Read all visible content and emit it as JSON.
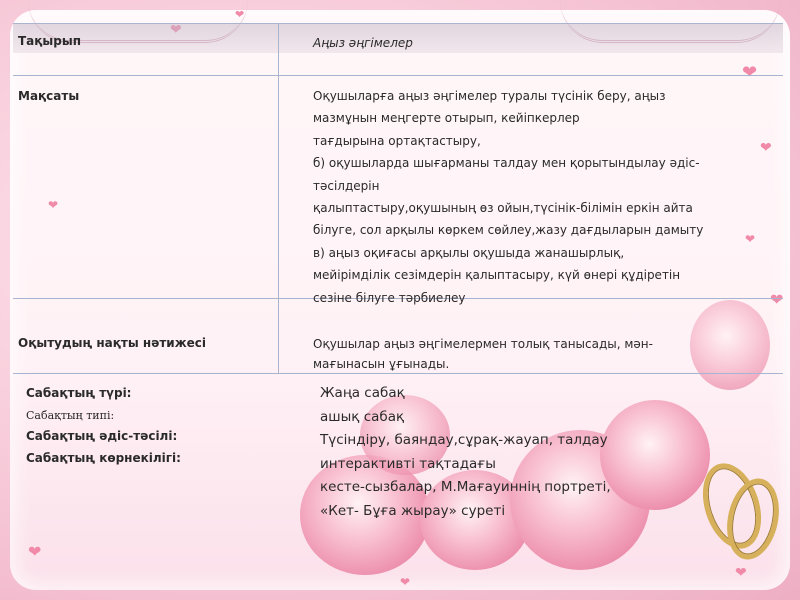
{
  "rows": [
    {
      "label": "Тақырып",
      "value_lines": [
        "Аңыз әңгімелер"
      ]
    },
    {
      "label": "Мақсаты",
      "value_lines": [
        "Оқушыларға аңыз әңгімелер туралы түсінік беру,  аңыз",
        "мазмұнын меңгерте отырып, кейіпкерлер",
        "тағдырына ортақтастыру,",
        "б) оқушыларда шығарманы талдау мен қорытындылау әдіс-",
        "тәсілдерін",
        "қалыптастыру,оқушының өз ойын,түсінік-білімін еркін айта",
        "білуге, сол арқылы көркем сөйлеу,жазу дағдыларын дамыту",
        "в) аңыз оқиғасы арқылы оқушыда жанашырлық,",
        "мейірімділік сезімдерін қалыптасыру, күй өнері құдіретін",
        "сезіне білуге тәрбиелеу"
      ]
    },
    {
      "label": "Оқытудың нақты нәтижесі",
      "value_lines": [
        "Оқушылар аңыз әңгімелермен толық танысады, мән-",
        "мағынасын ұғынады."
      ]
    }
  ],
  "lesson_labels": [
    "Сабақтың түрі:",
    "Сабақтың типі:",
    "Сабақтың әдіс-тәсілі:",
    "Сабақтың көрнекілігі:"
  ],
  "lesson_values": [
    "Жаңа сабақ",
    "ашық сабақ",
    "Түсіндіру, баяндау,сұрақ-жауап, талдау",
    "интерактивті тақтадағы",
    "кесте-сызбалар, М.Мағауиннің портреті,",
    "«Кет- Бұға жырау» суреті"
  ],
  "colors": {
    "rose": "#ee94b0",
    "gold_ring": "#d7b05c",
    "table_line": "#a9b5cf"
  }
}
